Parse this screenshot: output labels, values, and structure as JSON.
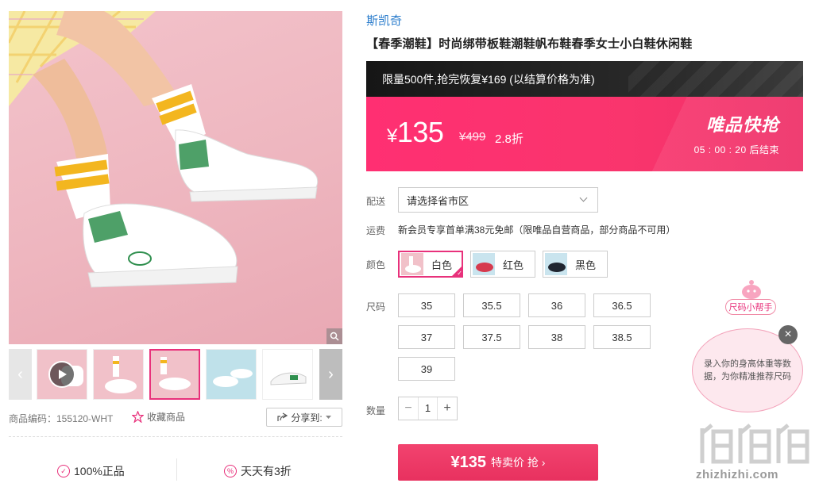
{
  "brand": "斯凯奇",
  "title": "【春季潮鞋】时尚绑带板鞋潮鞋帆布鞋春季女士小白鞋休闲鞋",
  "promo": {
    "banner": "限量500件,抢完恢复¥169 (以结算价格为准)",
    "currency": "¥",
    "price": "135",
    "original_price": "¥499",
    "discount": "2.8折",
    "flash_title": "唯品快抢",
    "countdown": "05 : 00 : 20  后结束",
    "accent": "#f9356d"
  },
  "delivery": {
    "label": "配送",
    "placeholder": "请选择省市区"
  },
  "shipping": {
    "label": "运费",
    "text": "新会员专享首单满38元免邮（限唯品自营商品，部分商品不可用）"
  },
  "colors": {
    "label": "颜色",
    "options": [
      {
        "name": "白色",
        "selected": true
      },
      {
        "name": "红色",
        "selected": false
      },
      {
        "name": "黑色",
        "selected": false
      }
    ]
  },
  "sizes": {
    "label": "尺码",
    "options": [
      "35",
      "35.5",
      "36",
      "36.5",
      "37",
      "37.5",
      "38",
      "38.5",
      "39"
    ]
  },
  "quantity": {
    "label": "数量",
    "minus": "−",
    "value": "1",
    "plus": "+"
  },
  "buy_button": {
    "price": "¥135",
    "label": "特卖价 抢 ›"
  },
  "gallery": {
    "prev": "‹",
    "next": "›",
    "sku": "商品编码：155120-WHT",
    "favorite": "收藏商品",
    "share": "分享到:"
  },
  "guarantees": [
    "100%正品",
    "天天有3折"
  ],
  "size_helper": {
    "tag": "尺码小帮手",
    "text": "录入你的身高体重等数据，为你精准推荐尺码",
    "close": "×"
  },
  "watermark": "zhizhizhi.com"
}
